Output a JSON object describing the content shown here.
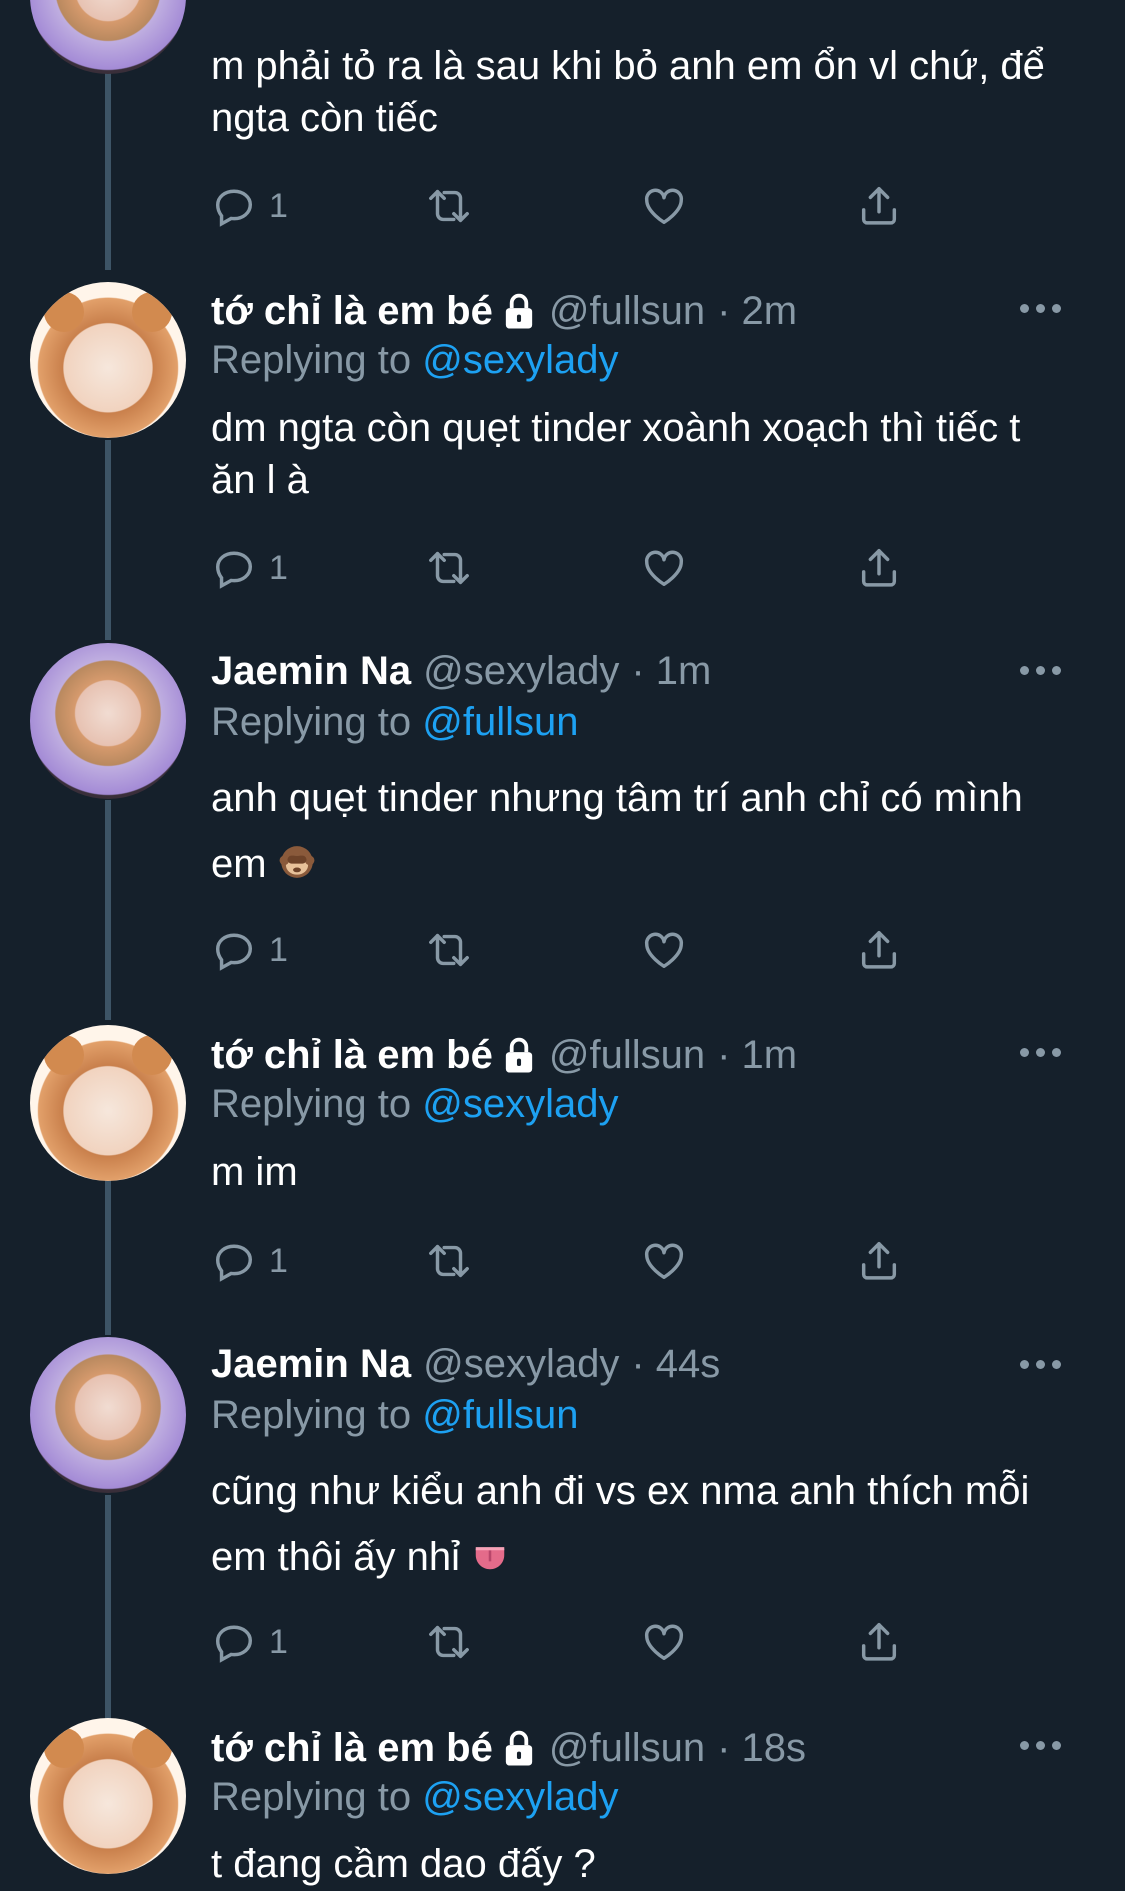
{
  "colors": {
    "background": "#15202b",
    "text": "#ffffff",
    "muted": "#8899a6",
    "accent": "#1da1f2"
  },
  "tweets": [
    {
      "author": "",
      "handle": "",
      "time": "",
      "replying_label": "",
      "replying_to": "",
      "text": "m phải tỏ ra là sau khi bỏ anh em ổn vl chứ, để ngta còn tiếc",
      "reply_count": "1"
    },
    {
      "author": "tớ chỉ là em bé",
      "handle": "@fullsun",
      "time": "· 2m",
      "replying_label": "Replying to",
      "replying_to": "@sexylady",
      "text": "dm ngta còn quẹt tinder xoành xoạch thì tiếc t ăn l à",
      "reply_count": "1"
    },
    {
      "author": "Jaemin Na",
      "handle": "@sexylady",
      "time": "· 1m",
      "replying_label": "Replying to",
      "replying_to": "@fullsun",
      "text": "anh quẹt tinder nhưng tâm trí anh chỉ có mình em",
      "emoji": "monkey-face",
      "reply_count": "1"
    },
    {
      "author": "tớ chỉ là em bé",
      "handle": "@fullsun",
      "time": "· 1m",
      "replying_label": "Replying to",
      "replying_to": "@sexylady",
      "text": "m im",
      "reply_count": "1"
    },
    {
      "author": "Jaemin Na",
      "handle": "@sexylady",
      "time": "· 44s",
      "replying_label": "Replying to",
      "replying_to": "@fullsun",
      "text": "cũng như kiểu anh đi vs ex nma anh thích mỗi em thôi ấy nhỉ",
      "emoji": "tongue",
      "reply_count": "1"
    },
    {
      "author": "tớ chỉ là em bé",
      "handle": "@fullsun",
      "time": "· 18s",
      "replying_label": "Replying to",
      "replying_to": "@sexylady",
      "text": "t đang cầm dao đấy ?",
      "reply_count": ""
    }
  ],
  "icons": [
    "reply-icon",
    "retweet-icon",
    "like-icon",
    "share-icon",
    "more-icon",
    "lock-icon"
  ]
}
